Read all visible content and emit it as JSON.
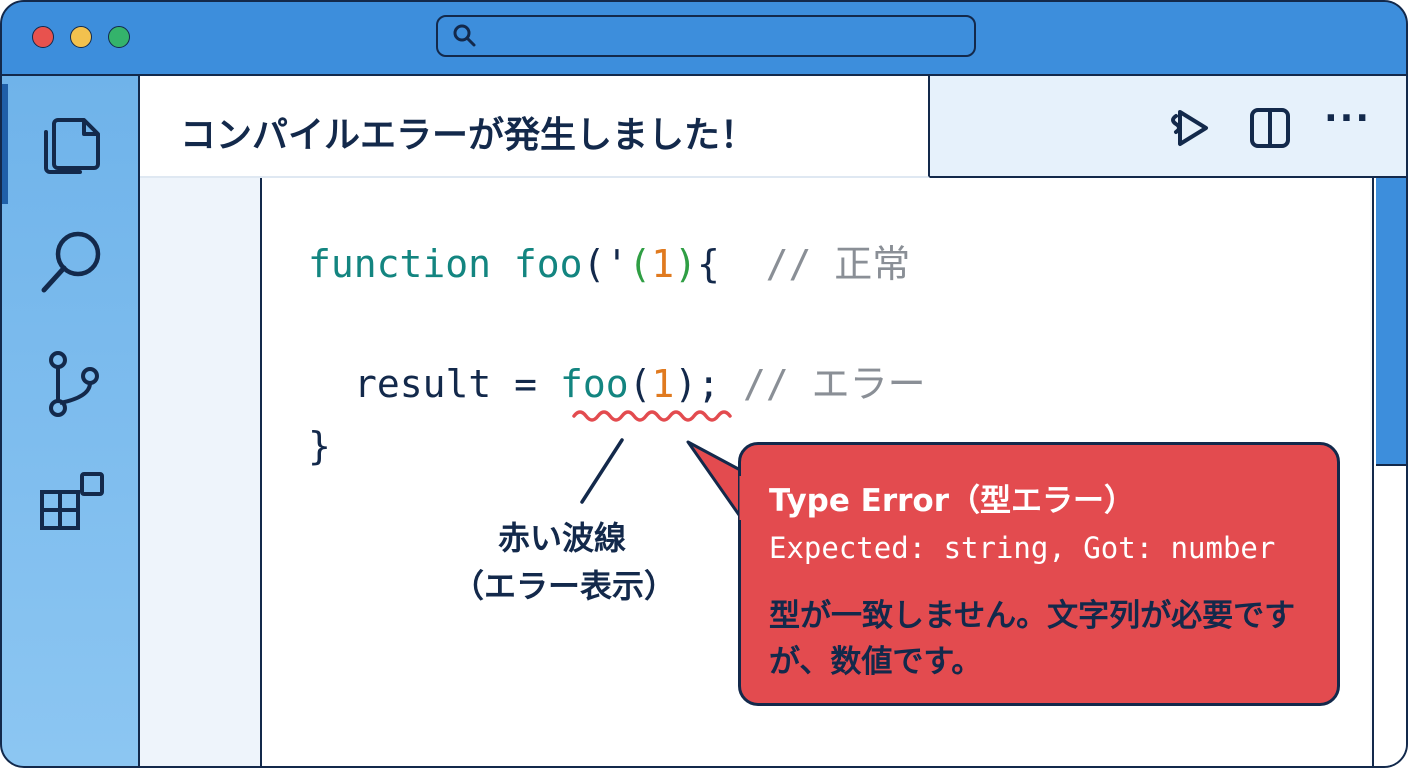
{
  "window": {
    "controls": [
      "close",
      "minimize",
      "maximize"
    ],
    "search": {
      "value": "",
      "icon": "search-icon"
    }
  },
  "sidebar": {
    "items": [
      {
        "name": "explorer",
        "icon": "files-icon"
      },
      {
        "name": "search",
        "icon": "search-icon"
      },
      {
        "name": "source-control",
        "icon": "source-control-icon"
      },
      {
        "name": "extensions",
        "icon": "extensions-icon"
      }
    ]
  },
  "tab": {
    "title": "コンパイルエラーが発生しました！"
  },
  "toolbar": {
    "icons": [
      "run-icon",
      "split-editor-icon",
      "more-icon"
    ],
    "more_label": "···"
  },
  "code": {
    "line1": {
      "keyword": "function",
      "name": "foo",
      "open_paren": "(",
      "quote": "'",
      "inner_open": "(",
      "number": "1",
      "close_paren": ")",
      "brace": "{",
      "comment": "// 正常"
    },
    "line2": {
      "variable": "result",
      "operator": "=",
      "call_name": "foo",
      "open_paren": "(",
      "number": "1",
      "close_paren": ")",
      "semicolon": ";",
      "comment": "// エラー"
    },
    "line3": "}"
  },
  "annotation": {
    "line1": "赤い波線",
    "line2": "（エラー表示）"
  },
  "error": {
    "title": "Type Error（型エラー）",
    "detail": "Expected: string, Got: number",
    "message": "型が一致しません。文字列が必要ですが、数値です。"
  },
  "colors": {
    "titlebar": "#3d8edc",
    "outline": "#13294b",
    "sidebar": "#6fb3ea",
    "keyword": "#138580",
    "number": "#e07a1f",
    "comment": "#8a8f96",
    "squiggle": "#e34b4f",
    "error_bg": "#e34b4f"
  }
}
